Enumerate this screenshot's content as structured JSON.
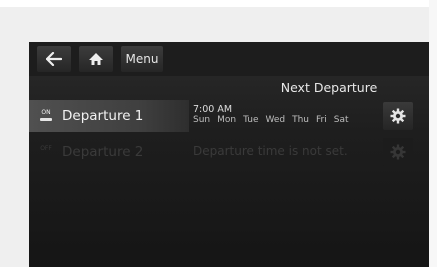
{
  "topbar": {
    "back_icon": "back-arrow-icon",
    "home_icon": "home-icon",
    "menu_label": "Menu"
  },
  "section": {
    "title": "Next Departure"
  },
  "departures": [
    {
      "toggle": "ON",
      "enabled": true,
      "name": "Departure 1",
      "time": "7:00 AM",
      "days": [
        "Sun",
        "Mon",
        "Tue",
        "Wed",
        "Thu",
        "Fri",
        "Sat"
      ],
      "settings_icon": "gear-icon"
    },
    {
      "toggle": "OFF",
      "enabled": false,
      "name": "Departure 2",
      "message": "Departure time is not set.",
      "settings_icon": "gear-icon"
    }
  ],
  "colors": {
    "screen_bg": "#1e1e1e",
    "text_primary": "#f2f2f2",
    "text_disabled": "#3a3a3a",
    "selected_row": "#505050"
  }
}
